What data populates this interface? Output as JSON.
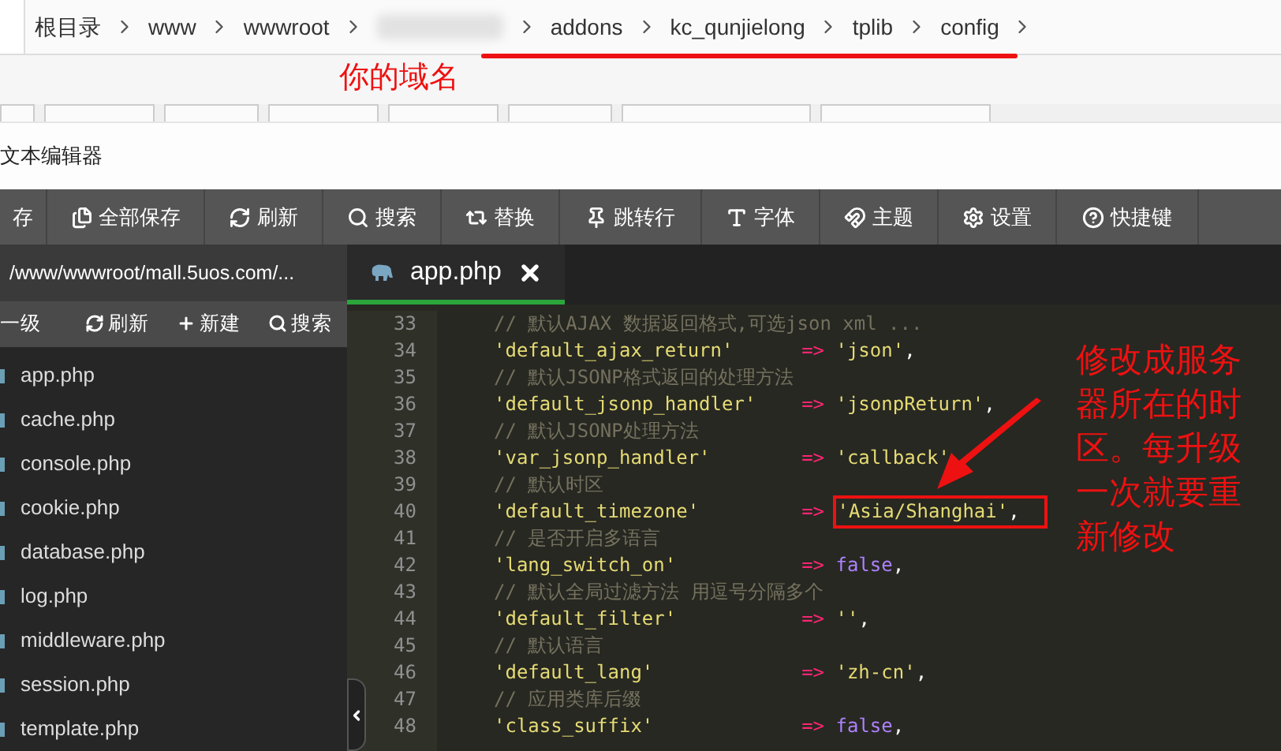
{
  "breadcrumb": {
    "items": [
      {
        "kind": "text",
        "label": "根目录"
      },
      {
        "kind": "text",
        "label": "www"
      },
      {
        "kind": "text",
        "label": "wwwroot"
      },
      {
        "kind": "blurred"
      },
      {
        "kind": "text",
        "label": "addons"
      },
      {
        "kind": "text",
        "label": "kc_qunjielong"
      },
      {
        "kind": "text",
        "label": "tplib"
      },
      {
        "kind": "text",
        "label": "config"
      }
    ]
  },
  "domain_note": "你的域名",
  "editor_title": "文本编辑器",
  "toolbar": [
    "存",
    "全部保存",
    "刷新",
    "搜索",
    "替换",
    "跳转行",
    "字体",
    "主题",
    "设置",
    "快捷键"
  ],
  "sidebar": {
    "path": "/www/wwwroot/mall.5uos.com/...",
    "actions": [
      "一级",
      "刷新",
      "新建",
      "搜索"
    ],
    "files": [
      "app.php",
      "cache.php",
      "console.php",
      "cookie.php",
      "database.php",
      "log.php",
      "middleware.php",
      "session.php",
      "template.php"
    ]
  },
  "tabs": [
    {
      "label": "app.php",
      "selected": true
    }
  ],
  "code": [
    {
      "number": "33",
      "kind": "comment",
      "text": "// 默认AJAX 数据返回格式,可选json xml ..."
    },
    {
      "number": "34",
      "kind": "string_pair",
      "key": "'default_ajax_return'",
      "value": "'json'",
      "boxed": false
    },
    {
      "number": "35",
      "kind": "comment",
      "text": "// 默认JSONP格式返回的处理方法"
    },
    {
      "number": "36",
      "kind": "string_pair",
      "key": "'default_jsonp_handler'",
      "value": "'jsonpReturn'",
      "boxed": false
    },
    {
      "number": "37",
      "kind": "comment",
      "text": "// 默认JSONP处理方法"
    },
    {
      "number": "38",
      "kind": "string_pair",
      "key": "'var_jsonp_handler'",
      "value": "'callback'",
      "boxed": false
    },
    {
      "number": "39",
      "kind": "comment",
      "text": "// 默认时区"
    },
    {
      "number": "40",
      "kind": "string_pair",
      "key": "'default_timezone'",
      "value": "'Asia/Shanghai'",
      "boxed": true
    },
    {
      "number": "41",
      "kind": "comment",
      "text": "// 是否开启多语言"
    },
    {
      "number": "42",
      "kind": "keyword_pair",
      "key": "'lang_switch_on'",
      "value": "false",
      "boxed": false
    },
    {
      "number": "43",
      "kind": "comment",
      "text": "// 默认全局过滤方法 用逗号分隔多个"
    },
    {
      "number": "44",
      "kind": "string_pair",
      "key": "'default_filter'",
      "value": "''",
      "boxed": false
    },
    {
      "number": "45",
      "kind": "comment",
      "text": "// 默认语言"
    },
    {
      "number": "46",
      "kind": "string_pair",
      "key": "'default_lang'",
      "value": "'zh-cn'",
      "boxed": false
    },
    {
      "number": "47",
      "kind": "comment",
      "text": "// 应用类库后缀"
    },
    {
      "number": "48",
      "kind": "keyword_pair",
      "key": "'class_suffix'",
      "value": "false",
      "boxed": false
    }
  ],
  "pair_arrow": "=>",
  "pair_comma": ",",
  "timezone_note": "修改成服务器所在的时区。每升级一次就要重新修改"
}
